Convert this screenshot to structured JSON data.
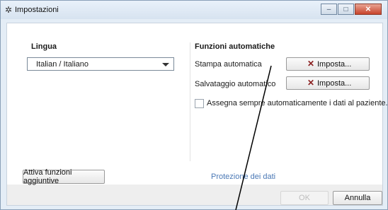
{
  "window": {
    "title": "Impostazioni",
    "icon": "gear-icon",
    "controls": {
      "minimize": "–",
      "maximize": "□",
      "close": "✕"
    }
  },
  "lingua": {
    "heading": "Lingua",
    "selected": "Italian / Italiano"
  },
  "funzioni": {
    "heading": "Funzioni automatiche",
    "stampa_label": "Stampa automatica",
    "salvataggio_label": "Salvataggio automatico",
    "imposta_label": "Imposta...",
    "assegna_label": "Assegna sempre automaticamente i dati al paziente."
  },
  "footer": {
    "attiva_label": "Attiva funzioni aggiuntive",
    "protezione_label": "Protezione dei dati",
    "ok_label": "OK",
    "annulla_label": "Annulla"
  },
  "colors": {
    "title_bg": "#d7e3f0",
    "link": "#4a78b5",
    "close_btn": "#c7432b"
  }
}
